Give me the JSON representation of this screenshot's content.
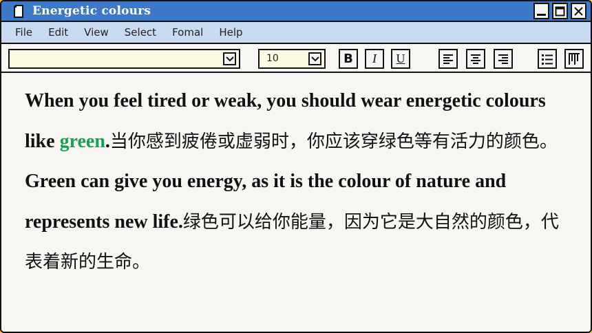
{
  "window": {
    "title": "Energetic colours",
    "title_icon": "document-icon",
    "controls": [
      "minimize-icon",
      "maximize-icon",
      "close-icon"
    ]
  },
  "menu": {
    "items": [
      "File",
      "Edit",
      "View",
      "Select",
      "Fomal",
      "Help"
    ]
  },
  "toolbar": {
    "font_value": "",
    "size_value": "10",
    "bold_label": "B",
    "italic_label": "I",
    "underline_label": "U",
    "align_buttons": [
      "align-left-icon",
      "align-center-icon",
      "align-right-icon"
    ],
    "list_buttons": [
      "bulleted-list-icon",
      "columns-icon"
    ]
  },
  "document": {
    "segments": [
      {
        "text": "When you feel tired or weak, you should wear energetic colours like ",
        "style": "en"
      },
      {
        "text": "green",
        "style": "green"
      },
      {
        "text": ".",
        "style": "en"
      },
      {
        "text": "当你感到疲倦或虚弱时，你应该穿绿色等有活力的颜色。",
        "style": "cn"
      },
      {
        "text": "Green can give you energy, as it is the colour of nature and represents new life.",
        "style": "en"
      },
      {
        "text": "绿色可以给你能量，因为它是大自然的颜色，代表着新的生命。",
        "style": "cn"
      }
    ]
  },
  "colors": {
    "titlebar": "#3d78c9",
    "menubar": "#c9daf1",
    "page_background": "#f6c23e",
    "accent_green": "#1aa055"
  }
}
